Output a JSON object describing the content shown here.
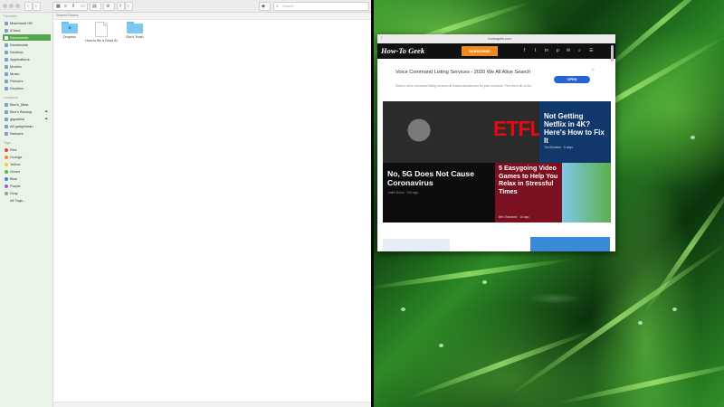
{
  "finder": {
    "search_placeholder": "Search",
    "path_label": "Shared Folders",
    "sidebar": {
      "sections": [
        {
          "heading": "Favorites",
          "items": [
            {
              "label": "Macintosh HD",
              "selected": false
            },
            {
              "label": "iCloud",
              "selected": false
            },
            {
              "label": "Documents",
              "selected": true
            },
            {
              "label": "Downloads",
              "selected": false
            },
            {
              "label": "Desktop",
              "selected": false
            },
            {
              "label": "Applications",
              "selected": false
            },
            {
              "label": "Movies",
              "selected": false
            },
            {
              "label": "Music",
              "selected": false
            },
            {
              "label": "Pictures",
              "selected": false
            },
            {
              "label": "Dropbox",
              "selected": false
            }
          ]
        },
        {
          "heading": "Locations",
          "items": [
            {
              "label": "Ben's_iMac",
              "selected": false
            },
            {
              "label": "Ben's Backup",
              "selected": false
            },
            {
              "label": "gigadrive",
              "selected": false
            },
            {
              "label": "All gadgetman",
              "selected": false
            },
            {
              "label": "Network",
              "selected": false
            }
          ]
        },
        {
          "heading": "Tags",
          "items": [
            {
              "label": "Red",
              "color": "#e0443a"
            },
            {
              "label": "Orange",
              "color": "#f0902a"
            },
            {
              "label": "Yellow",
              "color": "#f2cf2f"
            },
            {
              "label": "Green",
              "color": "#4cbb4a"
            },
            {
              "label": "Blue",
              "color": "#3b82e6"
            },
            {
              "label": "Purple",
              "color": "#a45bd6"
            },
            {
              "label": "Gray",
              "color": "#9a9a9a"
            },
            {
              "label": "All Tags...",
              "color": null
            }
          ]
        }
      ]
    },
    "files": [
      {
        "label": "Dropbox",
        "kind": "folder"
      },
      {
        "label": "How to Be a Good AI",
        "kind": "document"
      },
      {
        "label": "Don't Trash",
        "kind": "folder"
      }
    ]
  },
  "browser": {
    "url": "howtogeek.com",
    "site_logo": "How-To Geek",
    "subscribe_label": "SUBSCRIBE",
    "social_icons": [
      "f",
      "t",
      "in",
      "p",
      "✉",
      "☰"
    ],
    "ad": {
      "title": "Voice Command Listing Services - 2020 We All Alive Search",
      "sub": "Search voice command listing services at businessleads.com for your business. Find them all on bu...",
      "button": "OPEN"
    },
    "articles": [
      {
        "title": "",
        "banner_text": "ETFL"
      },
      {
        "title": "Not Getting Netflix in 4K? Here's How to Fix It",
        "meta": "Tim Brookes · 5 days"
      },
      {
        "title": "No, 5G Does Not Cause Coronavirus",
        "meta": "Justin Duino · 12h ago"
      },
      {
        "title": "5 Easygoing Video Games to Help You Relax in Stressful Times",
        "meta": "Ben Edwards · 1d ago"
      }
    ]
  },
  "colors": {
    "accent_green": "#53a84e",
    "subscribe_orange": "#f08a1c",
    "netflix_red": "#e50914",
    "article_blue": "#11386a"
  }
}
